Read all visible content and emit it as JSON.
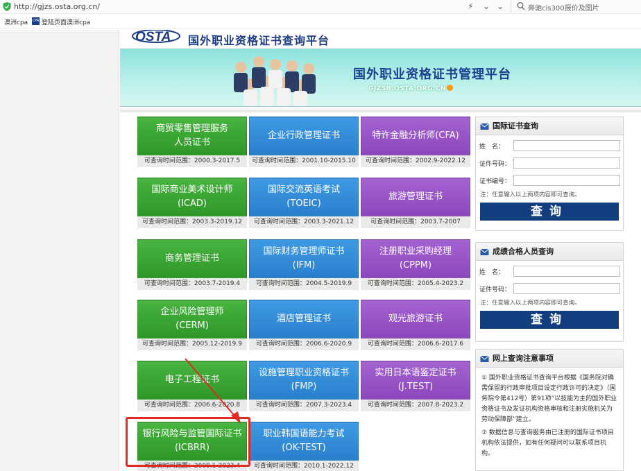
{
  "browser": {
    "url": "http://gjzs.osta.org.cn/",
    "search_placeholder": "奔驰cls300报价及图片",
    "bookmarks": [
      "澳洲cpa",
      "登陆页面澳洲cpa"
    ],
    "bookmark_icon_text": "CPA"
  },
  "header": {
    "logo_text": "OSTA",
    "title": "国外职业资格证书查询平台"
  },
  "banner": {
    "title": "国外职业资格证书管理平台",
    "url": "GJZSB.OSTA.ORG.CN"
  },
  "certs": [
    {
      "name": [
        "商贸零售管理服务",
        "人员证书"
      ],
      "range": "可查询时间范围：2000.3-2017.5",
      "color": "green"
    },
    {
      "name": [
        "企业行政管理证书"
      ],
      "range": "可查询时间范围：2001.10-2015.10",
      "color": "blue"
    },
    {
      "name": [
        "特许金融分析师(CFA)"
      ],
      "range": "可查询时间范围：2002.9-2022.12",
      "color": "purple"
    },
    {
      "name": [
        "国际商业美术设计师",
        "(ICAD)"
      ],
      "range": "可查询时间范围：2003.3-2019.12",
      "color": "green"
    },
    {
      "name": [
        "国际交流英语考试",
        "(TOEIC)"
      ],
      "range": "可查询时间范围：2003.3-2021.12",
      "color": "blue"
    },
    {
      "name": [
        "旅游管理证书"
      ],
      "range": "可查询时间范围：2003.7-2007",
      "color": "purple"
    },
    {
      "name": [
        "商务管理证书"
      ],
      "range": "可查询时间范围：2003.7-2019.4",
      "color": "green"
    },
    {
      "name": [
        "国际财务管理师证书",
        "(IFM)"
      ],
      "range": "可查询时间范围：2004.5-2019.9",
      "color": "blue"
    },
    {
      "name": [
        "注册职业采购经理",
        "(CPPM)"
      ],
      "range": "可查询时间范围：2005.4-2023.2",
      "color": "purple"
    },
    {
      "name": [
        "企业风险管理师",
        "(CERM)"
      ],
      "range": "可查询时间范围：2005.12-2019.9",
      "color": "green"
    },
    {
      "name": [
        "酒店管理证书"
      ],
      "range": "可查询时间范围：2006.6-2020.9",
      "color": "blue"
    },
    {
      "name": [
        "观光旅游证书"
      ],
      "range": "可查询时间范围：2006.6-2017.6",
      "color": "purple"
    },
    {
      "name": [
        "电子工程证书"
      ],
      "range": "可查询时间范围：2006.6-2020.8",
      "color": "green"
    },
    {
      "name": [
        "设施管理职业资格证书",
        "(FMP)"
      ],
      "range": "可查询时间范围：2007.3-2023.4",
      "color": "blue"
    },
    {
      "name": [
        "实用日本语鉴定证书",
        "(J.TEST)"
      ],
      "range": "可查询时间范围：2007.8-2023.2",
      "color": "purple"
    },
    {
      "name": [
        "银行风险与监管国际证书",
        "(ICBRR)"
      ],
      "range": "可查询时间范围：2008.1-2023.4",
      "color": "green"
    },
    {
      "name": [
        "职业韩国语能力考试",
        "(OK-TEST)"
      ],
      "range": "可查询时间范围：2010.1-2022.12",
      "color": "blue"
    }
  ],
  "panel_intl": {
    "title": "国际证书查询",
    "fields": [
      "姓　名：",
      "证件号码：",
      "证书编号："
    ],
    "note": "注：任意输入以上两项内容即可查询。",
    "button": "查询"
  },
  "panel_pass": {
    "title": "成绩合格人员查询",
    "fields": [
      "姓　名：",
      "证件号码："
    ],
    "note": "注：任意输入以上两项内容即可查询。",
    "button": "查询"
  },
  "panel_notice": {
    "title": "网上查询注意事项",
    "items": [
      "① 国外职业资格证书查询平台根据《国务院对确需保留的行政审批项目设定行政许可的决定》（国务院令第412号）第91项“以技能为主的国外职业资格证书及发证机构资格审核和注册实施机关为劳动保障部”建立。",
      "② 数据信息与查询服务由已注册的国际证书项目机构依法提供，如有任何疑问可以联系项目机构。"
    ]
  },
  "colors": {
    "green": "#3aa535",
    "blue": "#3589d6",
    "purple": "#9754c6",
    "query_button": "#123e7f",
    "highlight": "#e32a20"
  }
}
